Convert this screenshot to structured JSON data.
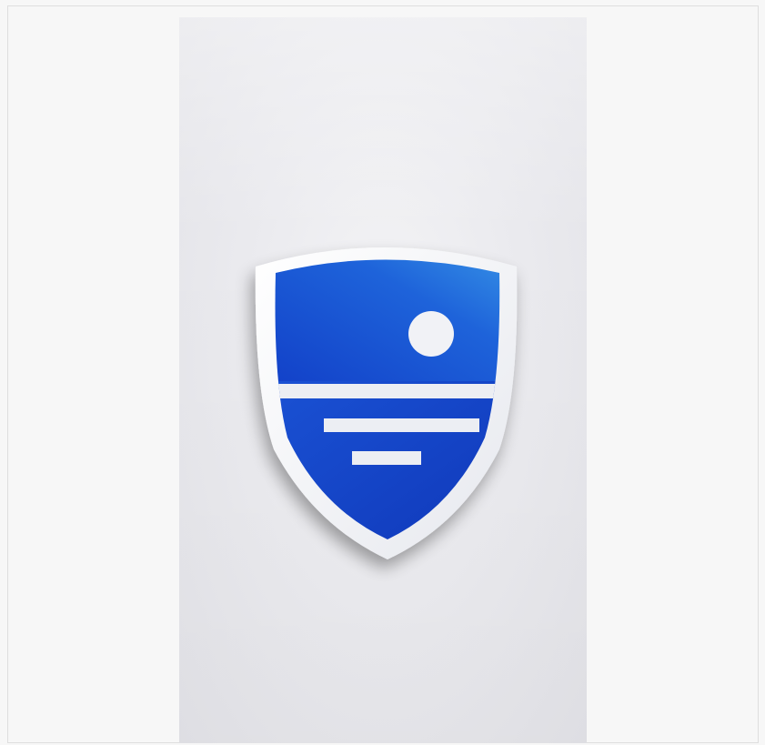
{
  "image": {
    "subject": "shield-logo-icon",
    "colors": {
      "page_background": "#f7f7f7",
      "panel_background": "#ebebef",
      "shield_blue_dark": "#1240c8",
      "shield_blue_light": "#2f8ee6",
      "shield_outline": "#f2f3f6",
      "sun": "#f2f3f6"
    }
  }
}
